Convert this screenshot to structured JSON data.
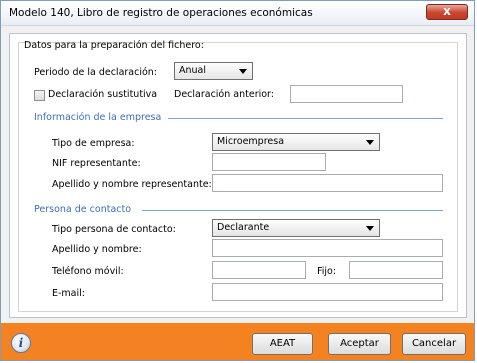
{
  "window": {
    "title": "Modelo 140, Libro de registro de operaciones económicas",
    "close_glyph": "x"
  },
  "datos": {
    "legend": "Datos para la preparación del fichero:",
    "periodo_label": "Periodo de la declaración:",
    "periodo_value": "Anual",
    "sustitutiva_label": "Declaración sustitutiva",
    "sustitutiva_checked": false,
    "anterior_label": "Declaración anterior:",
    "anterior_value": ""
  },
  "empresa": {
    "heading": "Información de la empresa",
    "tipo_label": "Tipo de empresa:",
    "tipo_value": "Microempresa",
    "nif_label": "NIF representante:",
    "nif_value": "",
    "apellido_label": "Apellido y nombre representante:",
    "apellido_value": ""
  },
  "contacto": {
    "heading": "Persona de contacto",
    "tipo_label": "Tipo persona de contacto:",
    "tipo_value": "Declarante",
    "apellido_label": "Apellido y nombre:",
    "apellido_value": "",
    "movil_label": "Teléfono móvil:",
    "movil_value": "",
    "fijo_label": "Fijo:",
    "fijo_value": "",
    "email_label": "E-mail:",
    "email_value": ""
  },
  "footer": {
    "info_glyph": "i",
    "aeat_label": "AEAT",
    "aceptar_label": "Aceptar",
    "cancelar_label": "Cancelar"
  },
  "colors": {
    "footer": "#f48220",
    "section_heading": "#3b6fb6",
    "close_button": "#c9452f"
  },
  "icons": [
    "close-icon",
    "info-icon",
    "chevron-down-icon",
    "checkbox"
  ]
}
